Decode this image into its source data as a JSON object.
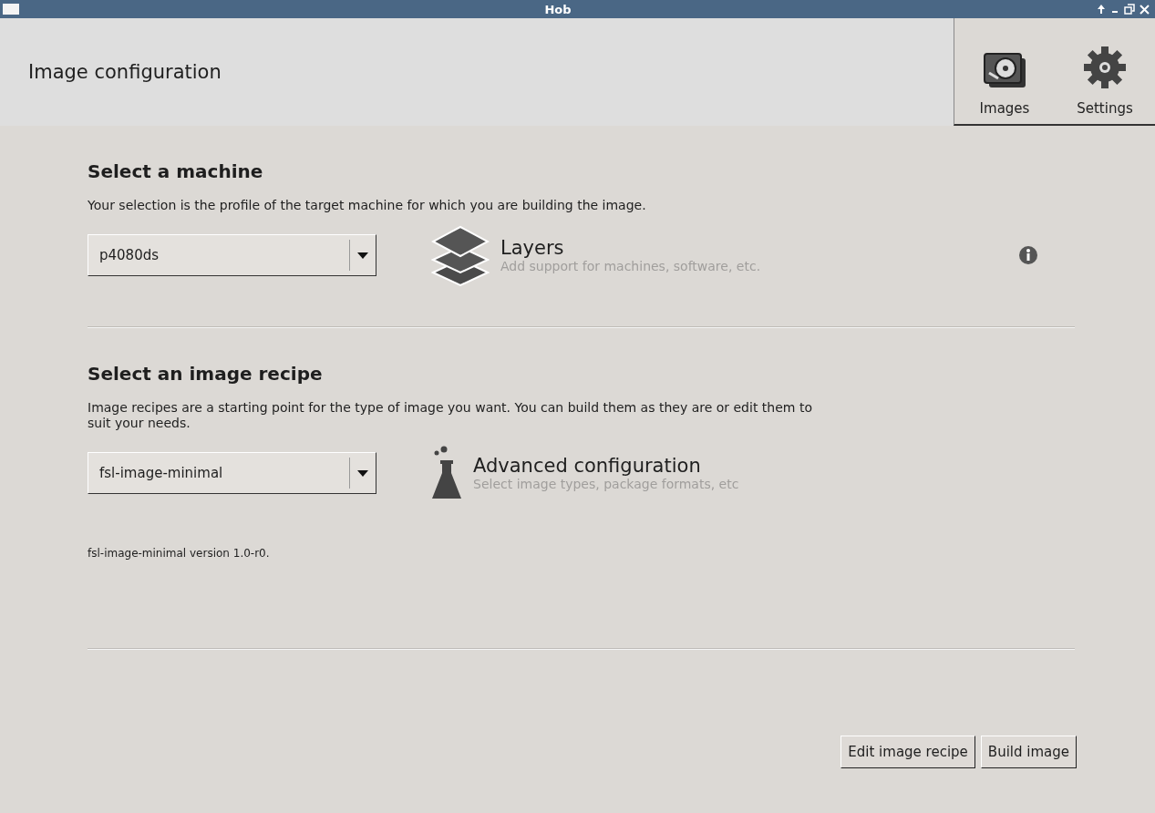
{
  "window": {
    "title": "Hob"
  },
  "header": {
    "title": "Image configuration",
    "toolbar": [
      {
        "label": "Images",
        "kind": "images"
      },
      {
        "label": "Settings",
        "kind": "settings"
      }
    ]
  },
  "machine_section": {
    "heading": "Select a machine",
    "description": "Your selection is the profile of the target machine for which you are building the image.",
    "combo": {
      "value": "p4080ds"
    },
    "link": {
      "title": "Layers",
      "subtitle": "Add support for machines, software, etc.",
      "kind": "layers"
    }
  },
  "recipe_section": {
    "heading": "Select an image recipe",
    "description": "Image recipes are a starting point for the type of image you want. You can build them as they are or edit them to suit your needs.",
    "combo": {
      "value": "fsl-image-minimal"
    },
    "link": {
      "title": "Advanced configuration",
      "subtitle": "Select image types, package formats, etc",
      "kind": "flask"
    },
    "version": "fsl-image-minimal version 1.0-r0."
  },
  "buttons": [
    "Edit image recipe",
    "Build image"
  ]
}
